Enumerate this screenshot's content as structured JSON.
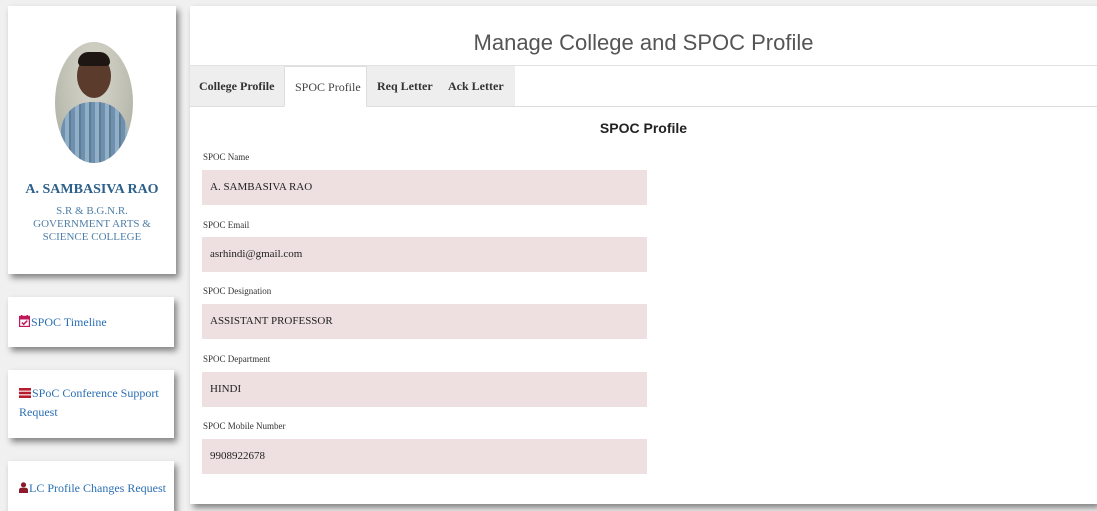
{
  "profile": {
    "name": "A. SAMBASIVA RAO",
    "college": "S.R & B.G.N.R. GOVERNMENT ARTS & SCIENCE COLLEGE"
  },
  "sidebar": {
    "items": [
      {
        "label": "SPOC Timeline",
        "icon": "calendar-check-icon"
      },
      {
        "label": "SPoC Conference Support Request",
        "icon": "server-icon"
      },
      {
        "label": "LC Profile Changes Request",
        "icon": "user-icon"
      }
    ]
  },
  "main": {
    "title": "Manage College and SPOC Profile",
    "tabs": [
      {
        "label": "College Profile"
      },
      {
        "label": "SPOC Profile"
      },
      {
        "label": "Req Letter"
      },
      {
        "label": "Ack Letter"
      }
    ],
    "active_tab": "SPOC Profile",
    "section_title": "SPOC Profile",
    "fields": [
      {
        "label": "SPOC Name",
        "value": "A. SAMBASIVA RAO"
      },
      {
        "label": "SPOC Email",
        "value": "asrhindi@gmail.com"
      },
      {
        "label": "SPOC Designation",
        "value": "ASSISTANT PROFESSOR"
      },
      {
        "label": "SPOC Department",
        "value": "HINDI"
      },
      {
        "label": "SPOC Mobile Number",
        "value": "9908922678"
      }
    ]
  },
  "colors": {
    "link": "#2a6fb3",
    "field_bg": "#eedfe0",
    "timeline_icon": "#c2185b",
    "server_icon": "#b71c2c",
    "user_icon": "#8b1a2a"
  }
}
